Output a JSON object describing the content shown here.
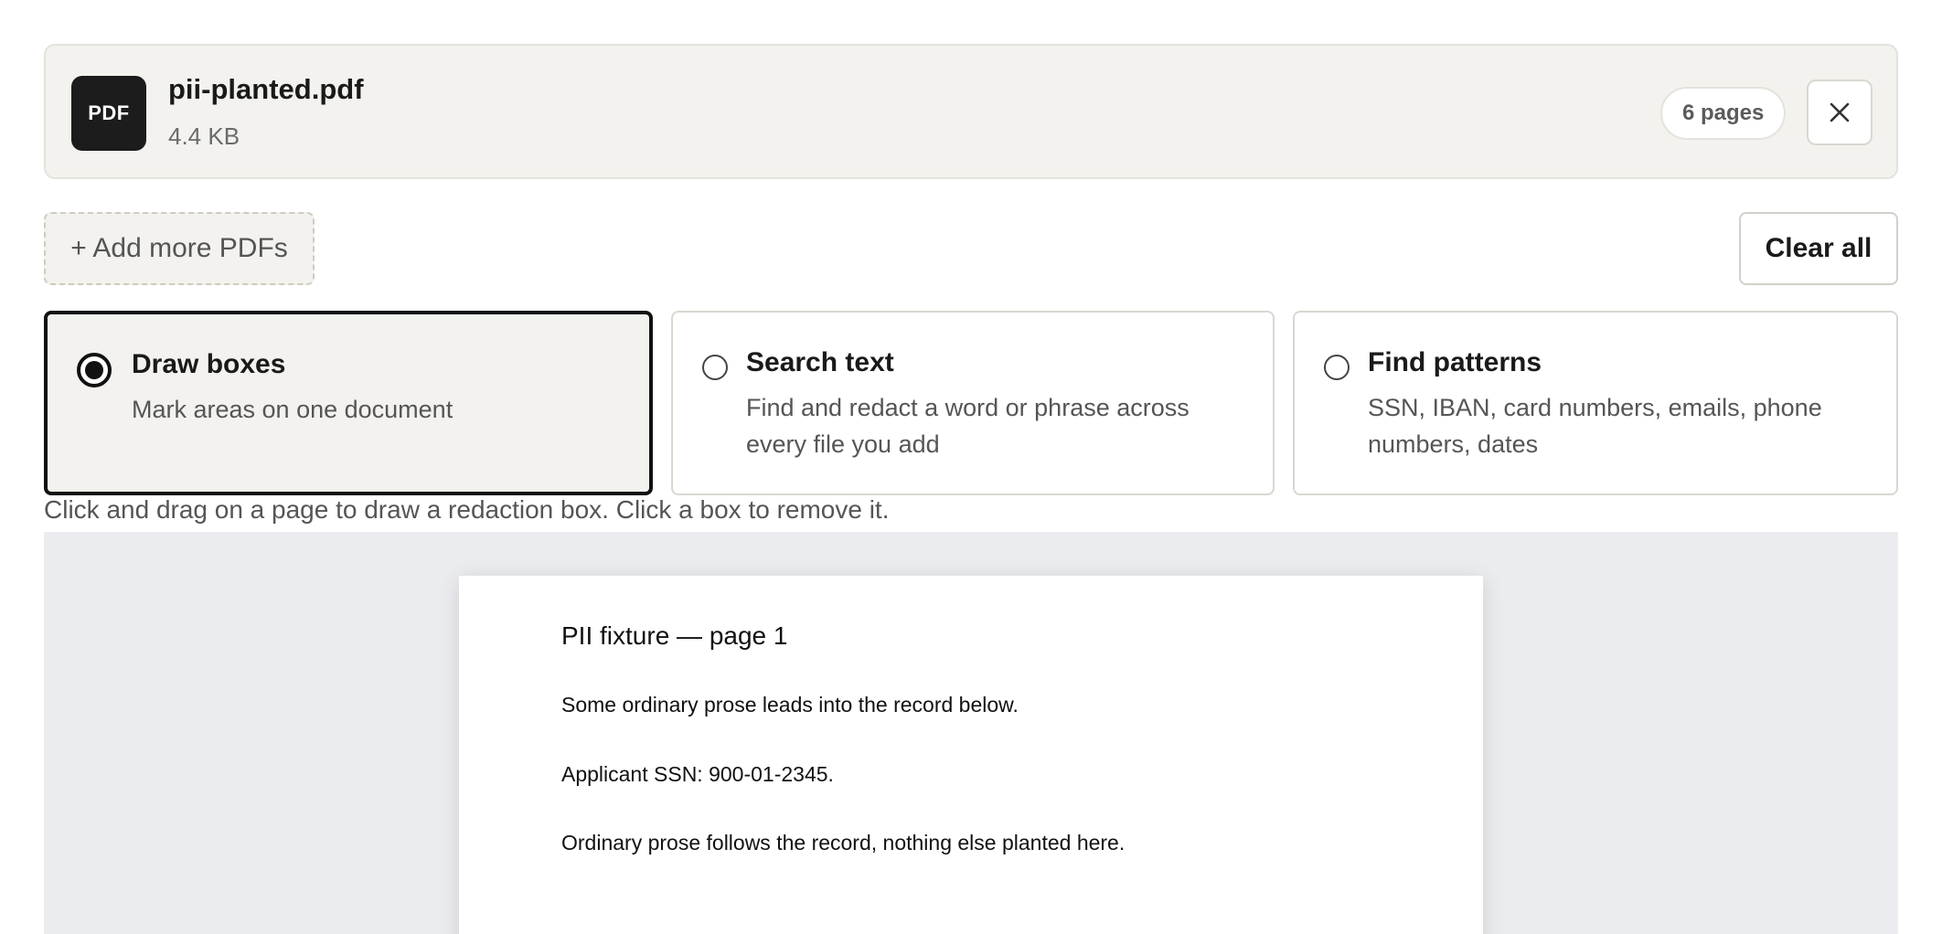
{
  "file": {
    "badge": "PDF",
    "name": "pii-planted.pdf",
    "size": "4.4 KB",
    "pages": "6 pages",
    "close_icon": "close-icon"
  },
  "actions": {
    "add_more": "+ Add more PDFs",
    "clear_all": "Clear all"
  },
  "modes": [
    {
      "title": "Draw boxes",
      "description": "Mark areas on one document",
      "selected": true
    },
    {
      "title": "Search text",
      "description": "Find and redact a word or phrase across every file you add",
      "selected": false
    },
    {
      "title": "Find patterns",
      "description": "SSN, IBAN, card numbers, emails, phone numbers, dates",
      "selected": false
    }
  ],
  "hint": "Click and drag on a page to draw a redaction box. Click a box to remove it.",
  "document": {
    "page_title": "PII fixture — page 1",
    "lines": [
      "Some ordinary prose leads into the record below.",
      "Applicant SSN: 900-01-2345.",
      "Ordinary prose follows the record, nothing else planted here."
    ]
  },
  "colors": {
    "accent": "#111111",
    "card_bg": "#f3f2ee",
    "viewer_bg": "#ebecef"
  }
}
